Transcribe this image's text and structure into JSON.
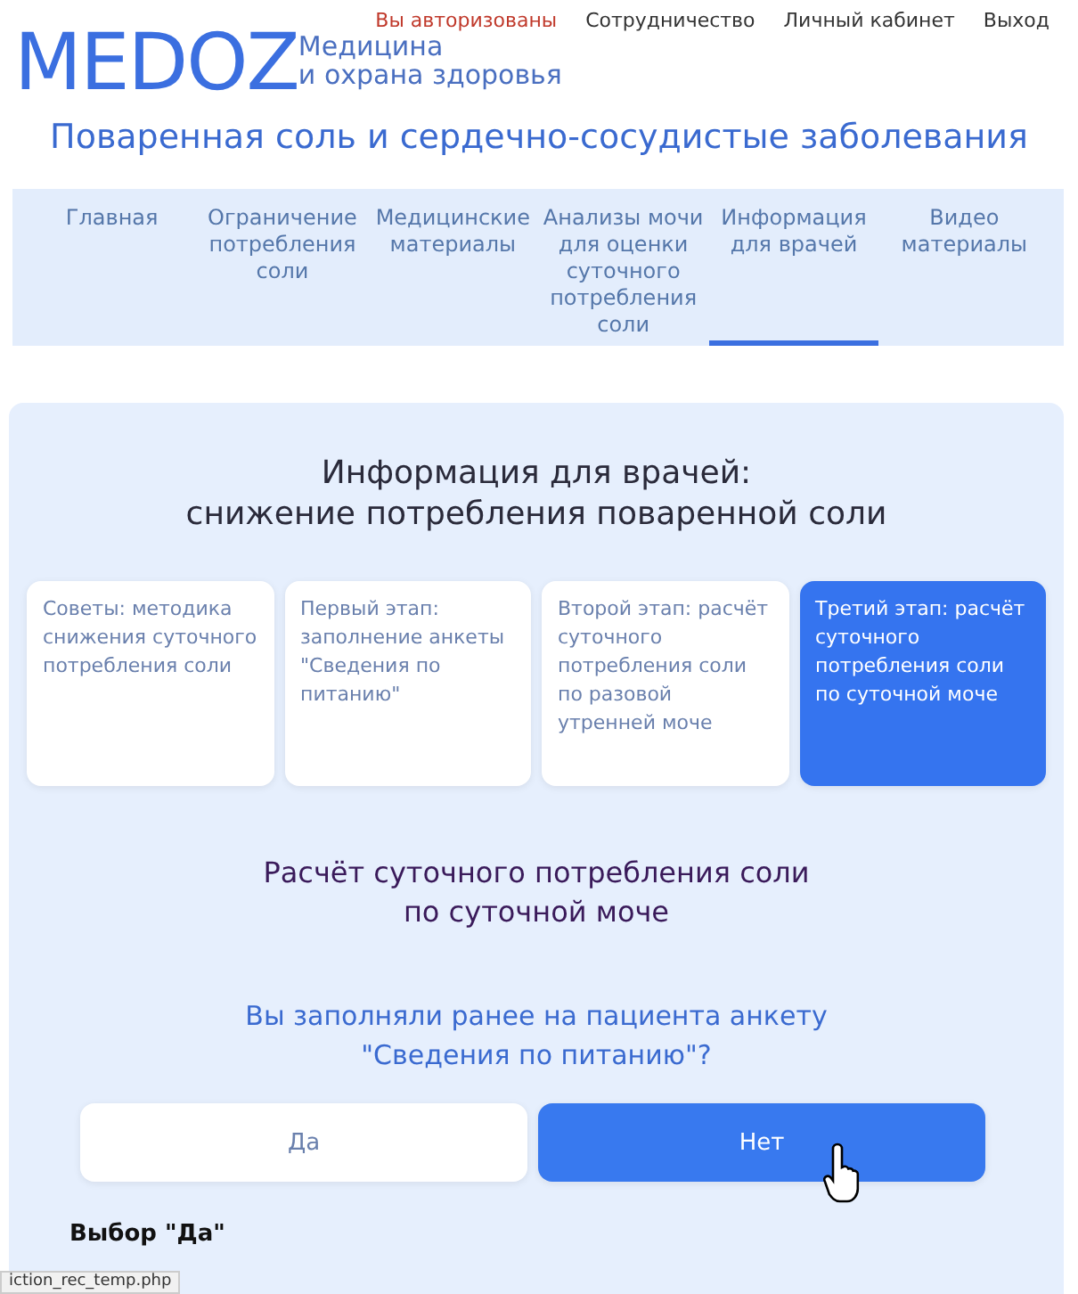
{
  "top_links": [
    {
      "label": "Вы авторизованы",
      "kind": "status"
    },
    {
      "label": "Сотрудничество",
      "kind": "link"
    },
    {
      "label": "Личный кабинет",
      "kind": "link"
    },
    {
      "label": "Выход",
      "kind": "link"
    }
  ],
  "logo": {
    "mark": "MEDOZ",
    "tagline": [
      "Медицина",
      "и охрана здоровья"
    ]
  },
  "site_title": "Поваренная соль и сердечно-сосудистые заболевания",
  "nav": [
    {
      "label": "Главная",
      "selected": false
    },
    {
      "label": "Ограничение потребления соли",
      "selected": false
    },
    {
      "label": "Медицинские материалы",
      "selected": false
    },
    {
      "label": "Анализы мочи для оценки суточного потребления соли",
      "selected": false
    },
    {
      "label": "Информация для врачей",
      "selected": true
    },
    {
      "label": "Видео материалы",
      "selected": false
    }
  ],
  "page_heading": [
    "Информация для врачей:",
    "снижение потребления поваренной соли"
  ],
  "steps": [
    {
      "label": "Советы: методика снижения суточного потребления соли",
      "selected": false
    },
    {
      "label": "Первый этап: заполнение анкеты \"Сведения по питанию\"",
      "selected": false
    },
    {
      "label": "Второй этап: расчёт суточного потребления соли по разовой утренней моче",
      "selected": false
    },
    {
      "label": "Третий этап: расчёт суточного потребления соли по суточной моче",
      "selected": true
    }
  ],
  "section_heading": [
    "Расчёт суточного потребления соли",
    "по суточной моче"
  ],
  "question": [
    "Вы заполняли ранее на пациента анкету",
    "\"Сведения по питанию\"?"
  ],
  "answers": [
    {
      "label": "Да",
      "selected": false
    },
    {
      "label": "Нет",
      "selected": true
    }
  ],
  "choice_label": "Выбор \"Да\"",
  "status_url": "iction_rec_temp.php"
}
